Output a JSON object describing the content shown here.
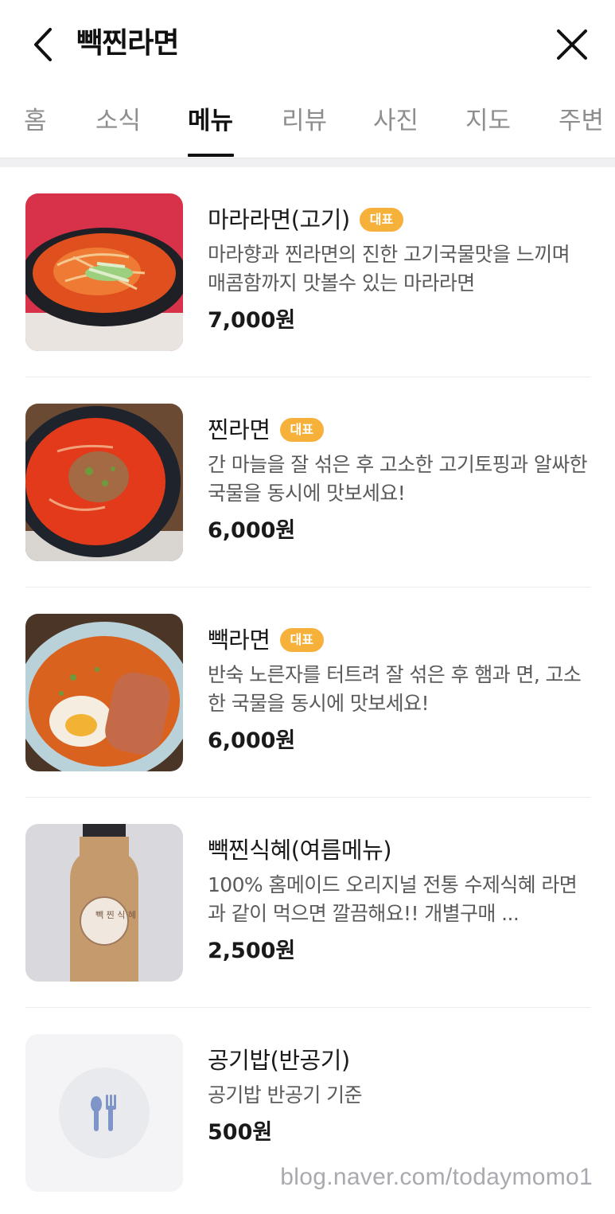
{
  "header": {
    "title": "빽찐라면",
    "back_icon": "chevron-left-icon",
    "close_icon": "close-icon"
  },
  "tabs": [
    {
      "label": "홈",
      "active": false
    },
    {
      "label": "소식",
      "active": false
    },
    {
      "label": "메뉴",
      "active": true
    },
    {
      "label": "리뷰",
      "active": false
    },
    {
      "label": "사진",
      "active": false
    },
    {
      "label": "지도",
      "active": false
    },
    {
      "label": "주변",
      "active": false
    }
  ],
  "menu": {
    "items": [
      {
        "name": "마라라면(고기)",
        "badge": "대표",
        "description": "마라향과 찐라면의 진한 고기국물맛을 느끼며 매콤함까지 맛볼수 있는 마라라면",
        "price": "7,000원",
        "image": "mala-ramen-photo"
      },
      {
        "name": "찐라면",
        "badge": "대표",
        "description": "간 마늘을 잘 섞은 후 고소한 고기토핑과 알싸한 국물을 동시에 맛보세요!",
        "price": "6,000원",
        "image": "jjin-ramen-photo"
      },
      {
        "name": "빽라면",
        "badge": "대표",
        "description": "반숙 노른자를 터트려 잘 섞은 후 햄과 면, 고소한 국물을 동시에 맛보세요!",
        "price": "6,000원",
        "image": "baek-ramen-photo"
      },
      {
        "name": "빽찐식혜(여름메뉴)",
        "badge": "",
        "description": "100% 홈메이드 오리지널 전통 수제식혜 라면과 같이 먹으면 깔끔해요!! 개별구매 ...",
        "price": "2,500원",
        "image": "sikhye-bottle-photo",
        "label_text": "빽 찐 식 혜"
      },
      {
        "name": "공기밥(반공기)",
        "badge": "",
        "description": "공기밥 반공기 기준",
        "price": "500원",
        "image": "utensils-placeholder-icon"
      }
    ]
  },
  "watermark": "blog.naver.com/todaymomo1",
  "colors": {
    "badge": "#f6b13b",
    "active_tab": "#111111",
    "inactive_tab": "#8e8e8e",
    "placeholder_icon": "#7f95c8"
  }
}
